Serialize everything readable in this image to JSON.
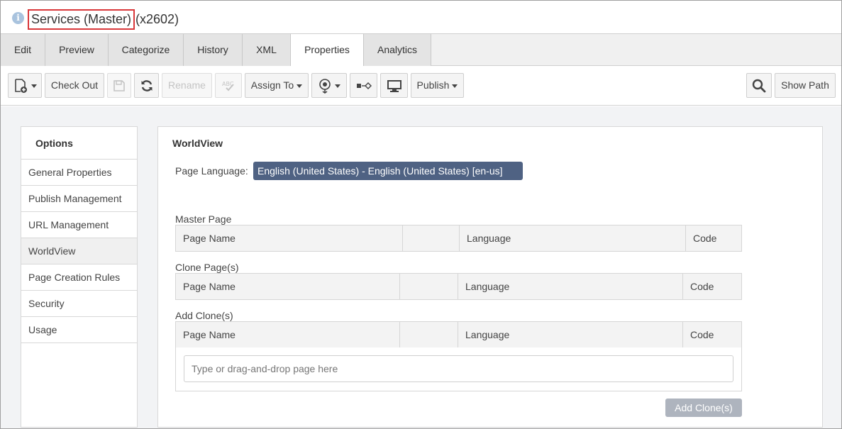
{
  "header": {
    "title": "Services (Master)",
    "id_suffix": "(x2602)",
    "info_icon_glyph": "i"
  },
  "tabs": [
    {
      "label": "Edit"
    },
    {
      "label": "Preview"
    },
    {
      "label": "Categorize"
    },
    {
      "label": "History"
    },
    {
      "label": "XML"
    },
    {
      "label": "Properties",
      "active": true
    },
    {
      "label": "Analytics"
    }
  ],
  "toolbar": {
    "new_page_icon": "new-page-icon",
    "check_out": "Check Out",
    "save_icon": "save-icon",
    "refresh_icon": "refresh-icon",
    "rename": "Rename",
    "spellcheck_icon": "spellcheck-icon",
    "assign_to": "Assign To",
    "workflow_icon": "workflow-icon",
    "link_icon": "link-icon",
    "monitor_icon": "monitor-icon",
    "publish": "Publish",
    "search_icon": "search-icon",
    "show_path": "Show Path"
  },
  "sidebar": {
    "heading": "Options",
    "items": [
      {
        "label": "General Properties"
      },
      {
        "label": "Publish Management"
      },
      {
        "label": "URL Management"
      },
      {
        "label": "WorldView",
        "active": true
      },
      {
        "label": "Page Creation Rules"
      },
      {
        "label": "Security"
      },
      {
        "label": "Usage"
      }
    ]
  },
  "panel": {
    "title": "WorldView",
    "page_language_label": "Page Language:",
    "page_language_value": "English (United States) - English (United States) [en-us]",
    "master_page": {
      "label": "Master Page",
      "columns": [
        "Page Name",
        "",
        "Language",
        "Code"
      ]
    },
    "clone_pages": {
      "label": "Clone Page(s)",
      "columns": [
        "Page Name",
        "",
        "Language",
        "Code"
      ]
    },
    "add_clones": {
      "label": "Add Clone(s)",
      "columns": [
        "Page Name",
        "",
        "Language",
        "Code"
      ],
      "input_placeholder": "Type or drag-and-drop page here",
      "button_label": "Add Clone(s)"
    }
  },
  "colors": {
    "title_highlight": "#d9373a",
    "language_select_bg": "#4f6283",
    "add_button_bg": "#aeb4be"
  }
}
